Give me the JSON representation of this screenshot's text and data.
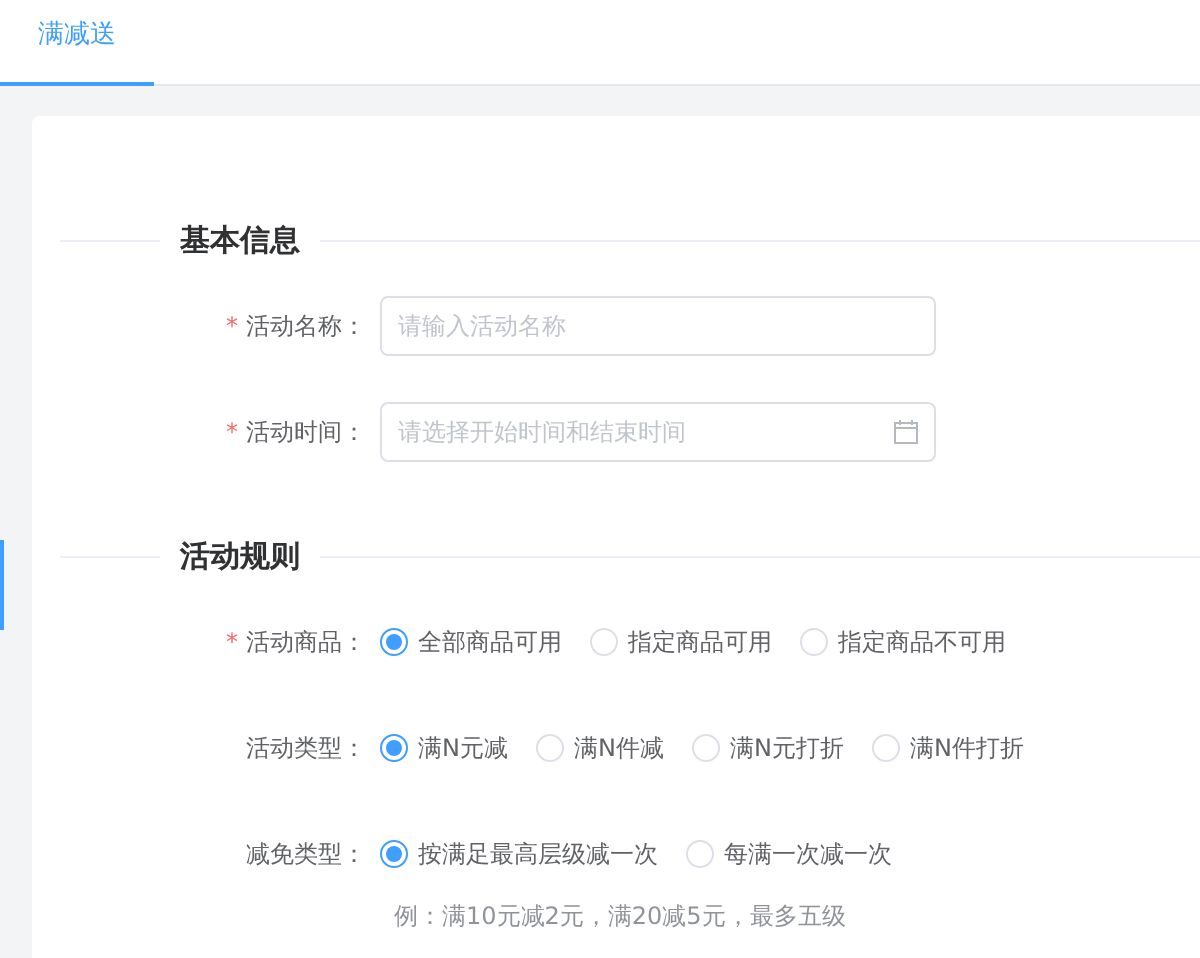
{
  "tabs": [
    {
      "label": "满减送",
      "selected": true
    }
  ],
  "sections": [
    {
      "title": "基本信息",
      "fields": [
        {
          "kind": "input",
          "label": "活动名称：",
          "required_mark": "*",
          "placeholder": "请输入活动名称"
        },
        {
          "kind": "input",
          "label": "活动时间：",
          "required_mark": "*",
          "placeholder": "请选择开始时间和结束时间",
          "calendar": true
        }
      ]
    },
    {
      "title": "活动规则",
      "fields": [
        {
          "kind": "radio",
          "label": "活动商品：",
          "required_mark": "*",
          "options": [
            {
              "label": "全部商品可用",
              "selected": true
            },
            {
              "label": "指定商品可用",
              "selected": false
            },
            {
              "label": "指定商品不可用",
              "selected": false
            }
          ]
        },
        {
          "kind": "radio",
          "label": "活动类型：",
          "options": [
            {
              "label": "满N元减",
              "selected": true
            },
            {
              "label": "满N件减",
              "selected": false
            },
            {
              "label": "满N元打折",
              "selected": false
            },
            {
              "label": "满N件打折",
              "selected": false
            }
          ]
        },
        {
          "kind": "radio",
          "label": "减免类型：",
          "options": [
            {
              "label": "按满足最高层级减一次",
              "selected": true
            },
            {
              "label": "每满一次减一次",
              "selected": false
            }
          ],
          "hint": "例：满10元减2元，满20减5元，最多五级"
        }
      ]
    }
  ]
}
